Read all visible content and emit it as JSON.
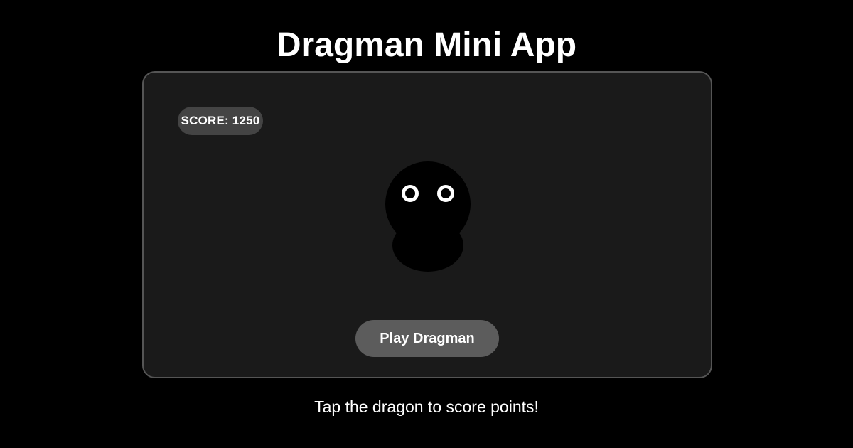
{
  "app": {
    "title": "Dragman Mini App"
  },
  "game": {
    "score_text": "SCORE: 1250",
    "dragon_icon": "dragon-character-icon",
    "play_button_label": "Play Dragman"
  },
  "footer": {
    "hint": "Tap the dragon to score points!"
  },
  "colors": {
    "background": "#000000",
    "panel": "#1a1a1a",
    "panel_border": "#555555",
    "score_badge": "#444444",
    "play_button": "#5c5c5c",
    "text": "#ffffff"
  }
}
